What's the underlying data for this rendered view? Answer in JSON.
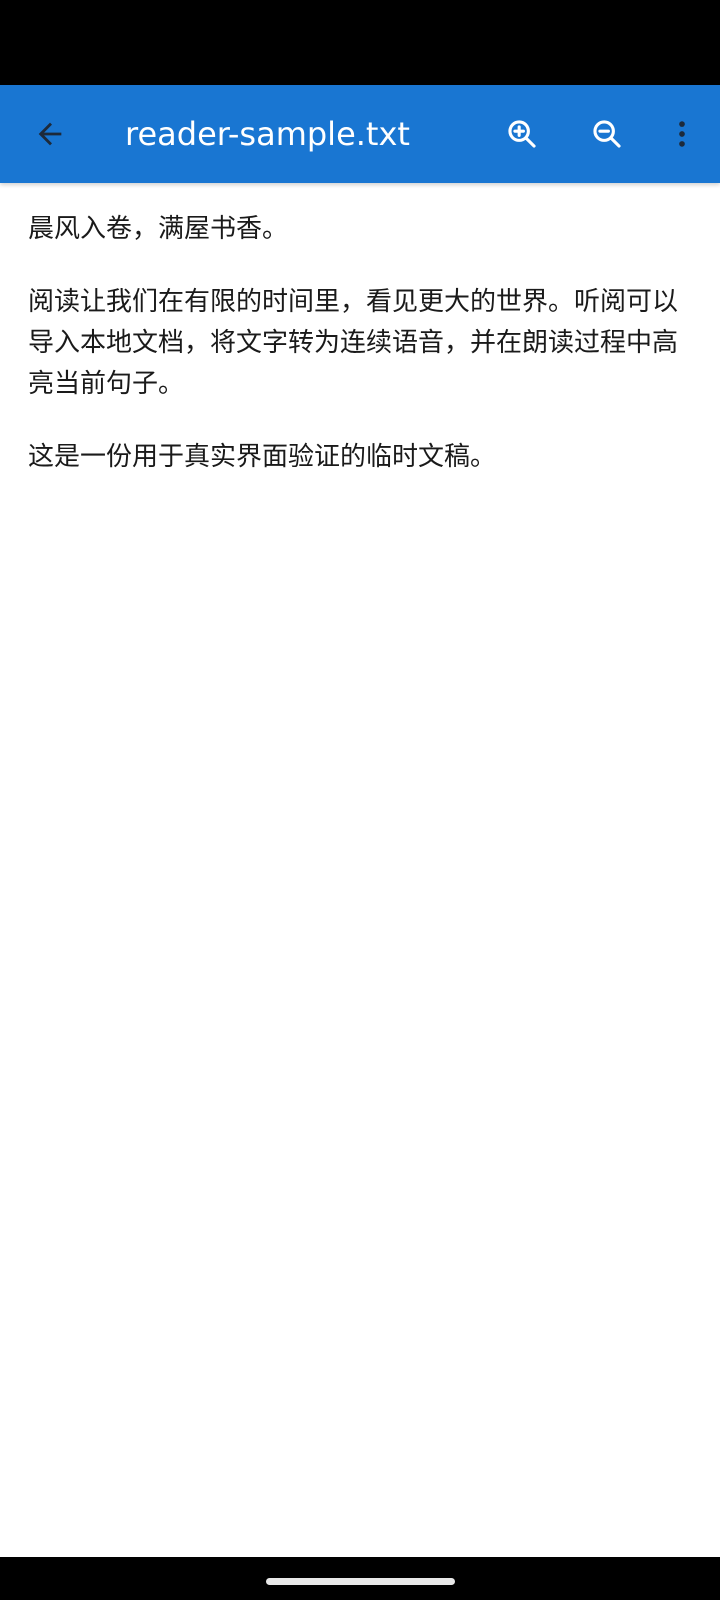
{
  "app_bar": {
    "title": "reader-sample.txt",
    "background_color": "#1976D2",
    "icons": {
      "back": "arrow-back-icon",
      "zoom_in": "zoom-in-icon",
      "zoom_out": "zoom-out-icon",
      "more": "more-vert-icon"
    }
  },
  "document": {
    "paragraphs": [
      "晨风入卷，满屋书香。",
      "阅读让我们在有限的时间里，看见更大的世界。听阅可以导入本地文档，将文字转为连续语音，并在朗读过程中高亮当前句子。",
      "这是一份用于真实界面验证的临时文稿。"
    ]
  }
}
